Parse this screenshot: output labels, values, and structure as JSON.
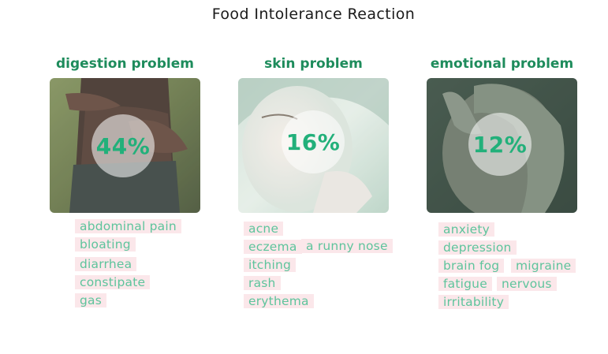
{
  "title": "Food Intolerance Reaction",
  "colors": {
    "heading": "#1e8c5c",
    "percent": "#22b07a",
    "tag_text": "#5ec49c",
    "tag_bg": "#fbe7ea"
  },
  "categories": [
    {
      "heading": "digestion problem",
      "percent": "44%",
      "symptoms": [
        "abdominal pain",
        "bloating",
        "diarrhea",
        "constipate",
        "gas"
      ]
    },
    {
      "heading": "skin problem",
      "percent": "16%",
      "symptoms": [
        "acne",
        "eczema",
        "a runny nose",
        "itching",
        "rash",
        "erythema"
      ]
    },
    {
      "heading": "emotional problem",
      "percent": "12%",
      "symptoms": [
        "anxiety",
        "depression",
        "brain fog",
        "migraine",
        "fatigue",
        "nervous",
        "irritability"
      ]
    }
  ]
}
